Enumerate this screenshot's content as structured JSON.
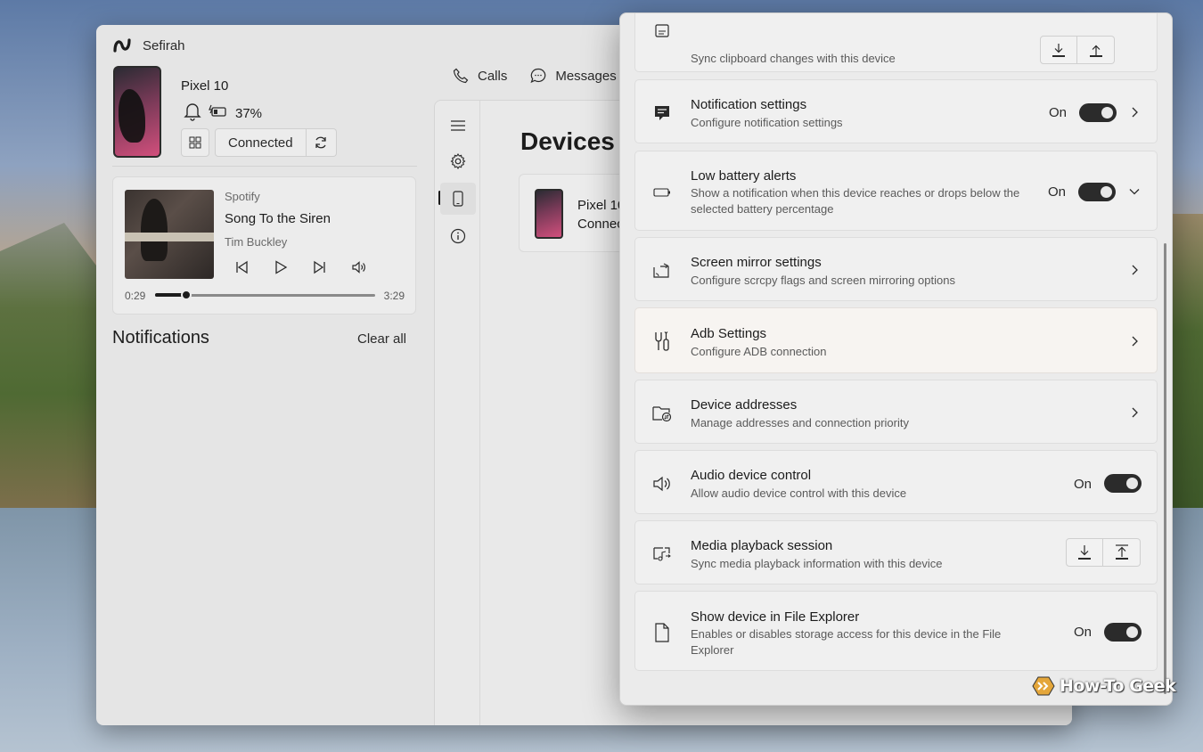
{
  "app": {
    "title": "Sefirah"
  },
  "device": {
    "name": "Pixel 10",
    "battery": "37%",
    "connection_label": "Connected"
  },
  "media": {
    "source": "Spotify",
    "song": "Song To the Siren",
    "artist": "Tim Buckley",
    "elapsed": "0:29",
    "duration": "3:29",
    "progress": 0.14
  },
  "notifications": {
    "title": "Notifications",
    "clear_all": "Clear all"
  },
  "tabs": [
    {
      "label": "Calls"
    },
    {
      "label": "Messages"
    }
  ],
  "devices_page": {
    "title": "Devices",
    "item_name": "Pixel 10",
    "item_status": "Connec"
  },
  "settings": {
    "partial_row": {
      "desc": "Sync clipboard changes with this device"
    },
    "rows": [
      {
        "title": "Notification settings",
        "desc": "Configure notification settings",
        "state": "On"
      },
      {
        "title": "Low battery alerts",
        "desc": "Show a notification when this device reaches or drops below the selected battery percentage",
        "state": "On"
      },
      {
        "title": "Screen mirror settings",
        "desc": "Configure scrcpy flags and screen mirroring options"
      },
      {
        "title": "Adb Settings",
        "desc": "Configure ADB connection"
      },
      {
        "title": "Device addresses",
        "desc": "Manage addresses and connection priority"
      },
      {
        "title": "Audio device control",
        "desc": "Allow audio device control with this device",
        "state": "On"
      },
      {
        "title": "Media playback session",
        "desc": "Sync media playback information with this device"
      },
      {
        "title": "Show device in File Explorer",
        "desc": "Enables or disables storage access for this device in the File Explorer",
        "state": "On"
      }
    ]
  },
  "watermark": {
    "text": "How-To Geek"
  },
  "colors": {
    "toggle_on": "#2b2b2b",
    "highlight": "#ffffff",
    "accent": "#1c1c1c"
  }
}
